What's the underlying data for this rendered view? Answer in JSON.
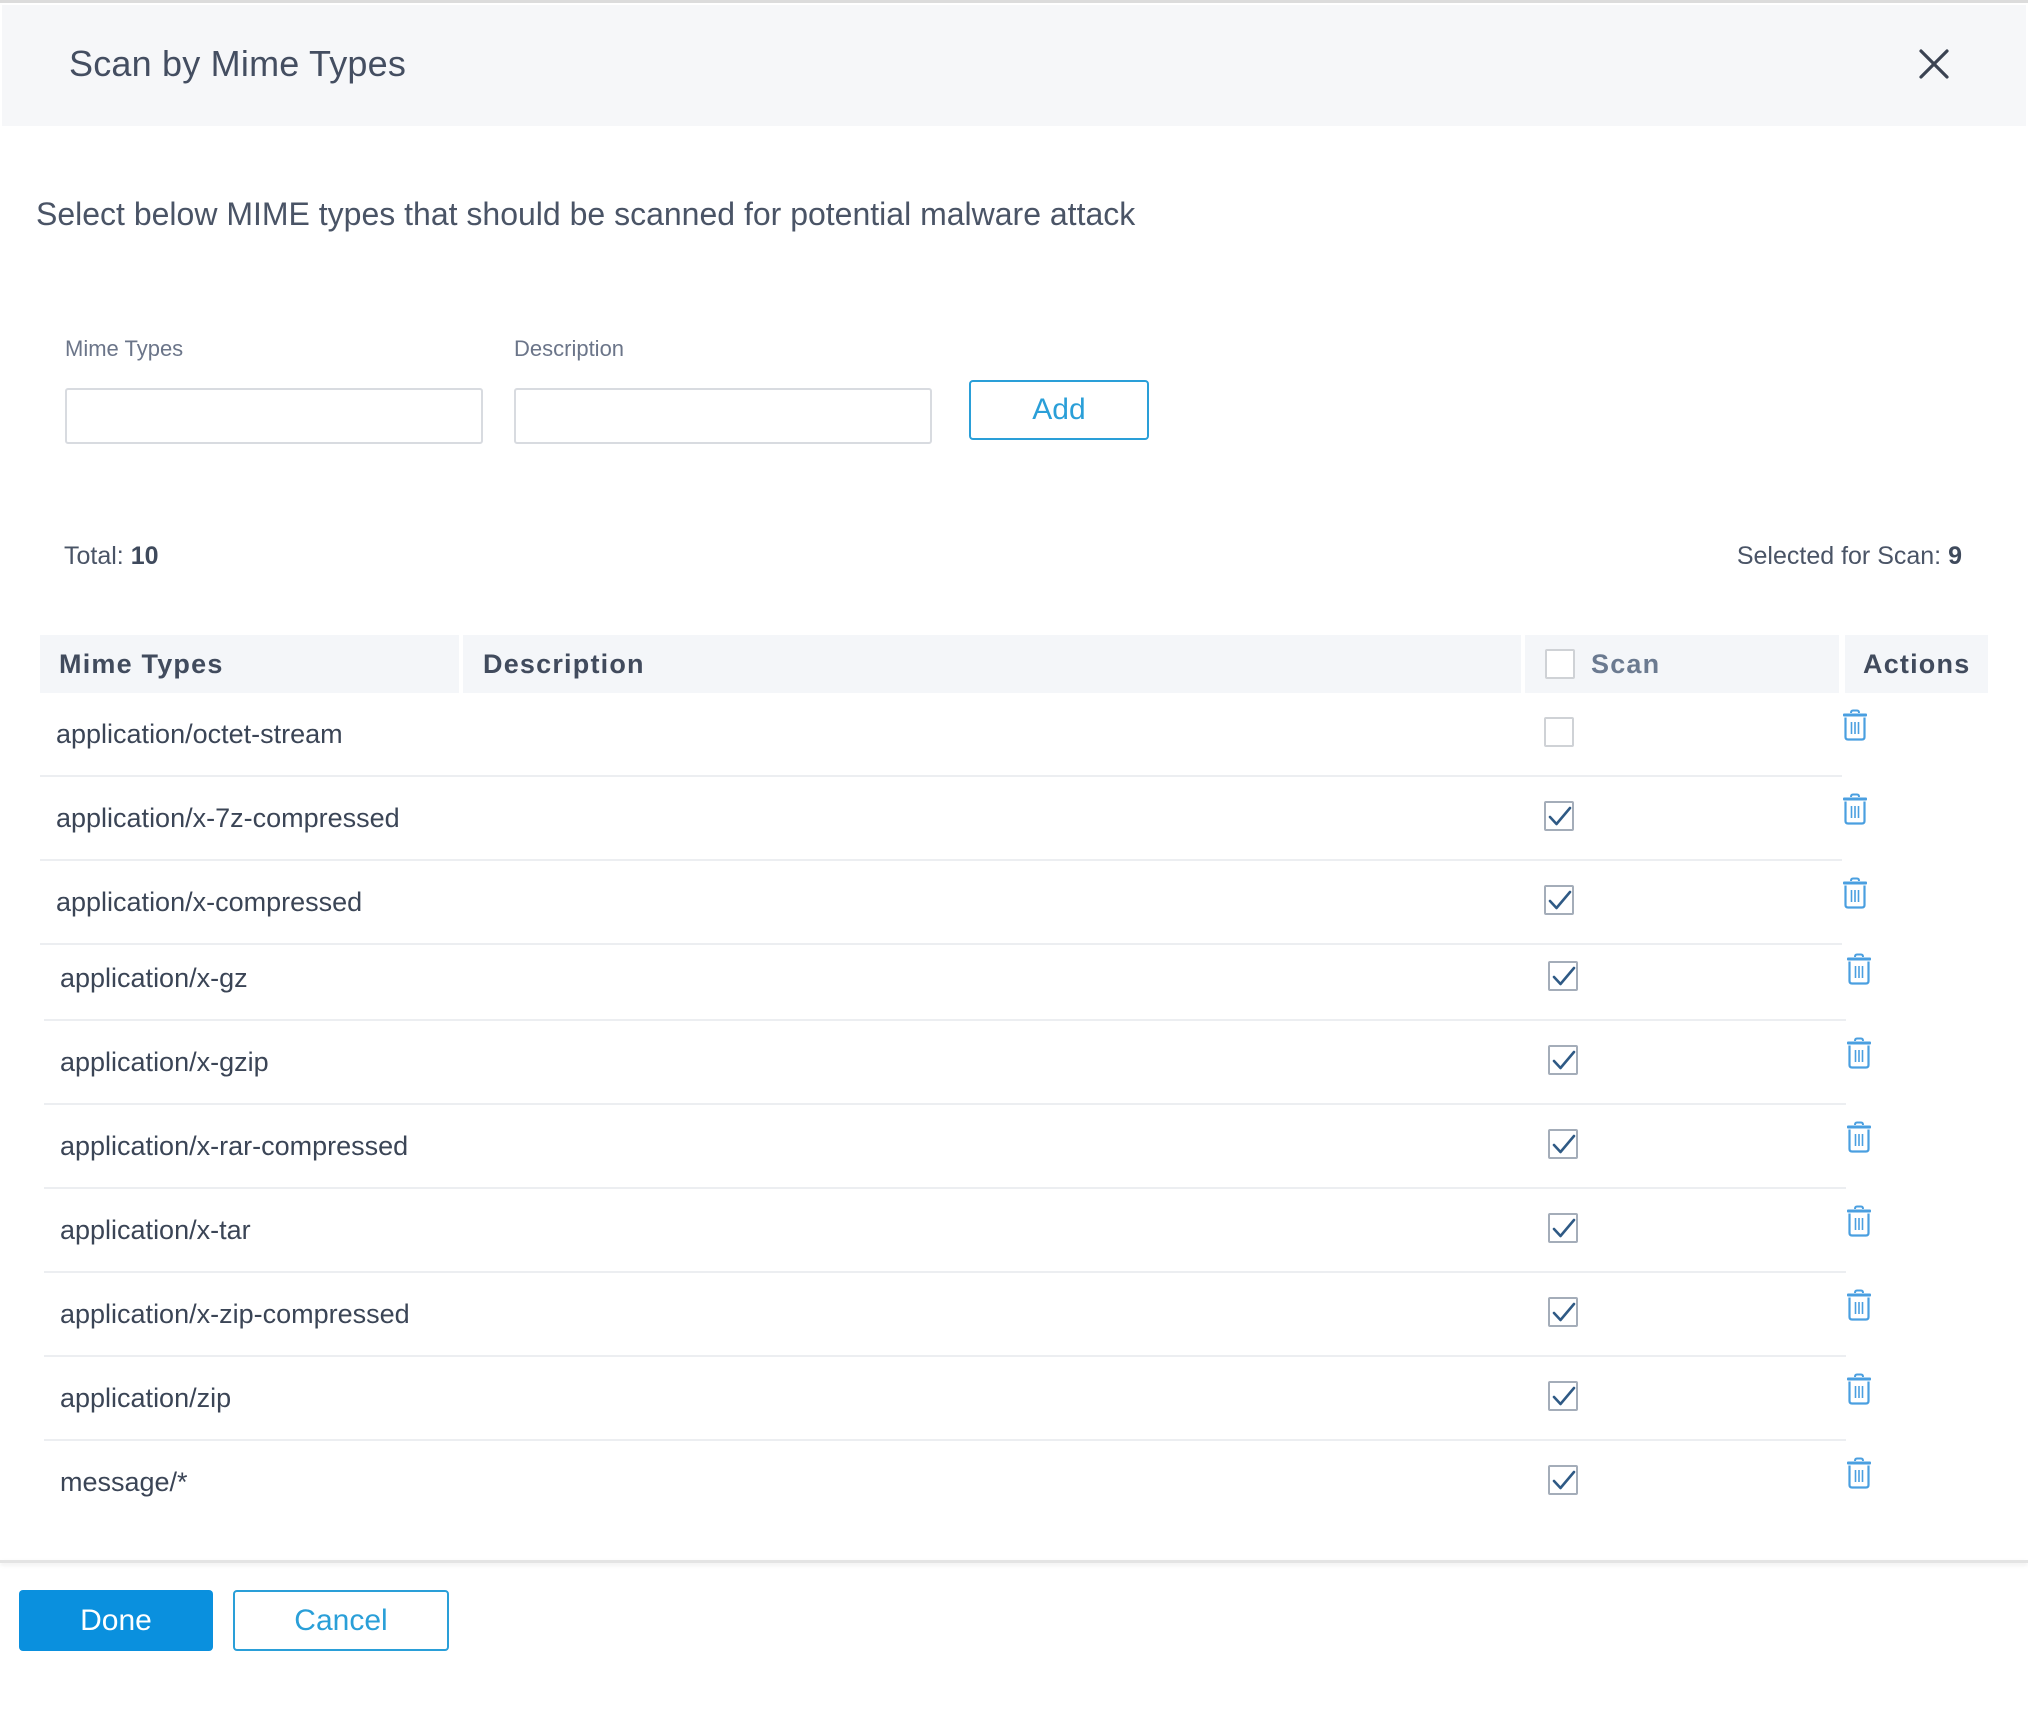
{
  "dialog": {
    "title": "Scan by Mime Types",
    "close_icon": "close-icon",
    "intro": "Select below MIME types that should be scanned for potential malware attack"
  },
  "form": {
    "mime_label": "Mime Types",
    "mime_value": "",
    "mime_placeholder": "",
    "description_label": "Description",
    "description_value": "",
    "description_placeholder": "",
    "add_label": "Add"
  },
  "summary": {
    "total_label": "Total:",
    "total_value": "10",
    "selected_label": "Selected for Scan:",
    "selected_value": "9"
  },
  "table": {
    "columns": [
      "Mime Types",
      "Description",
      "Scan",
      "Actions"
    ],
    "select_all_checked": false,
    "rows": [
      {
        "mime": "application/octet-stream",
        "description": "",
        "scan": false,
        "action_icon": "trash-icon"
      },
      {
        "mime": "application/x-7z-compressed",
        "description": "",
        "scan": true,
        "action_icon": "trash-icon"
      },
      {
        "mime": "application/x-compressed",
        "description": "",
        "scan": true,
        "action_icon": "trash-icon"
      },
      {
        "mime": "application/x-gz",
        "description": "",
        "scan": true,
        "action_icon": "trash-icon"
      },
      {
        "mime": "application/x-gzip",
        "description": "",
        "scan": true,
        "action_icon": "trash-icon"
      },
      {
        "mime": "application/x-rar-compressed",
        "description": "",
        "scan": true,
        "action_icon": "trash-icon"
      },
      {
        "mime": "application/x-tar",
        "description": "",
        "scan": true,
        "action_icon": "trash-icon"
      },
      {
        "mime": "application/x-zip-compressed",
        "description": "",
        "scan": true,
        "action_icon": "trash-icon"
      },
      {
        "mime": "application/zip",
        "description": "",
        "scan": true,
        "action_icon": "trash-icon"
      },
      {
        "mime": "message/*",
        "description": "",
        "scan": true,
        "action_icon": "trash-icon"
      }
    ]
  },
  "footer": {
    "done_label": "Done",
    "cancel_label": "Cancel"
  },
  "colors": {
    "primary": "#0a90de",
    "outline_accent": "#2a9fd8",
    "trash_icon": "#4a9fe0",
    "check_mark": "#2f5a85",
    "header_bg": "#f6f7f9",
    "table_header_bg": "#f4f6f9"
  }
}
